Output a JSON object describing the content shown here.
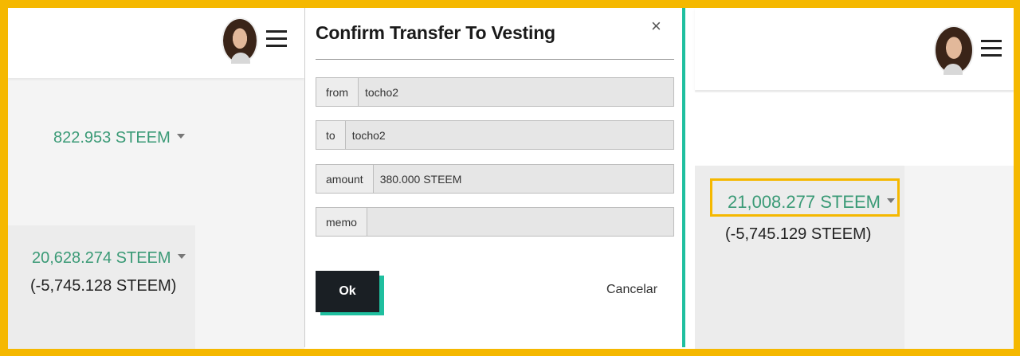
{
  "left": {
    "balance_primary": "822.953 STEEM",
    "balance_savings": "20,628.274 STEEM",
    "balance_delta": "(-5,745.128 STEEM)"
  },
  "modal": {
    "title": "Confirm Transfer To Vesting",
    "close": "×",
    "fields": [
      {
        "label": "from",
        "value": "tocho2"
      },
      {
        "label": "to",
        "value": "tocho2"
      },
      {
        "label": "amount",
        "value": "380.000 STEEM"
      },
      {
        "label": "memo",
        "value": ""
      }
    ],
    "ok_label": "Ok",
    "cancel_label": "Cancelar"
  },
  "right": {
    "balance_highlight": "21,008.277 STEEM",
    "balance_delta": "(-5,745.129 STEEM)"
  },
  "colors": {
    "frame": "#f5b800",
    "steem_green": "#3a9a76",
    "accent_teal": "#1fbf9f",
    "ok_button": "#1a1f24"
  },
  "icons": [
    "user-avatar",
    "hamburger-menu-icon",
    "close-icon",
    "dropdown-caret-icon"
  ]
}
